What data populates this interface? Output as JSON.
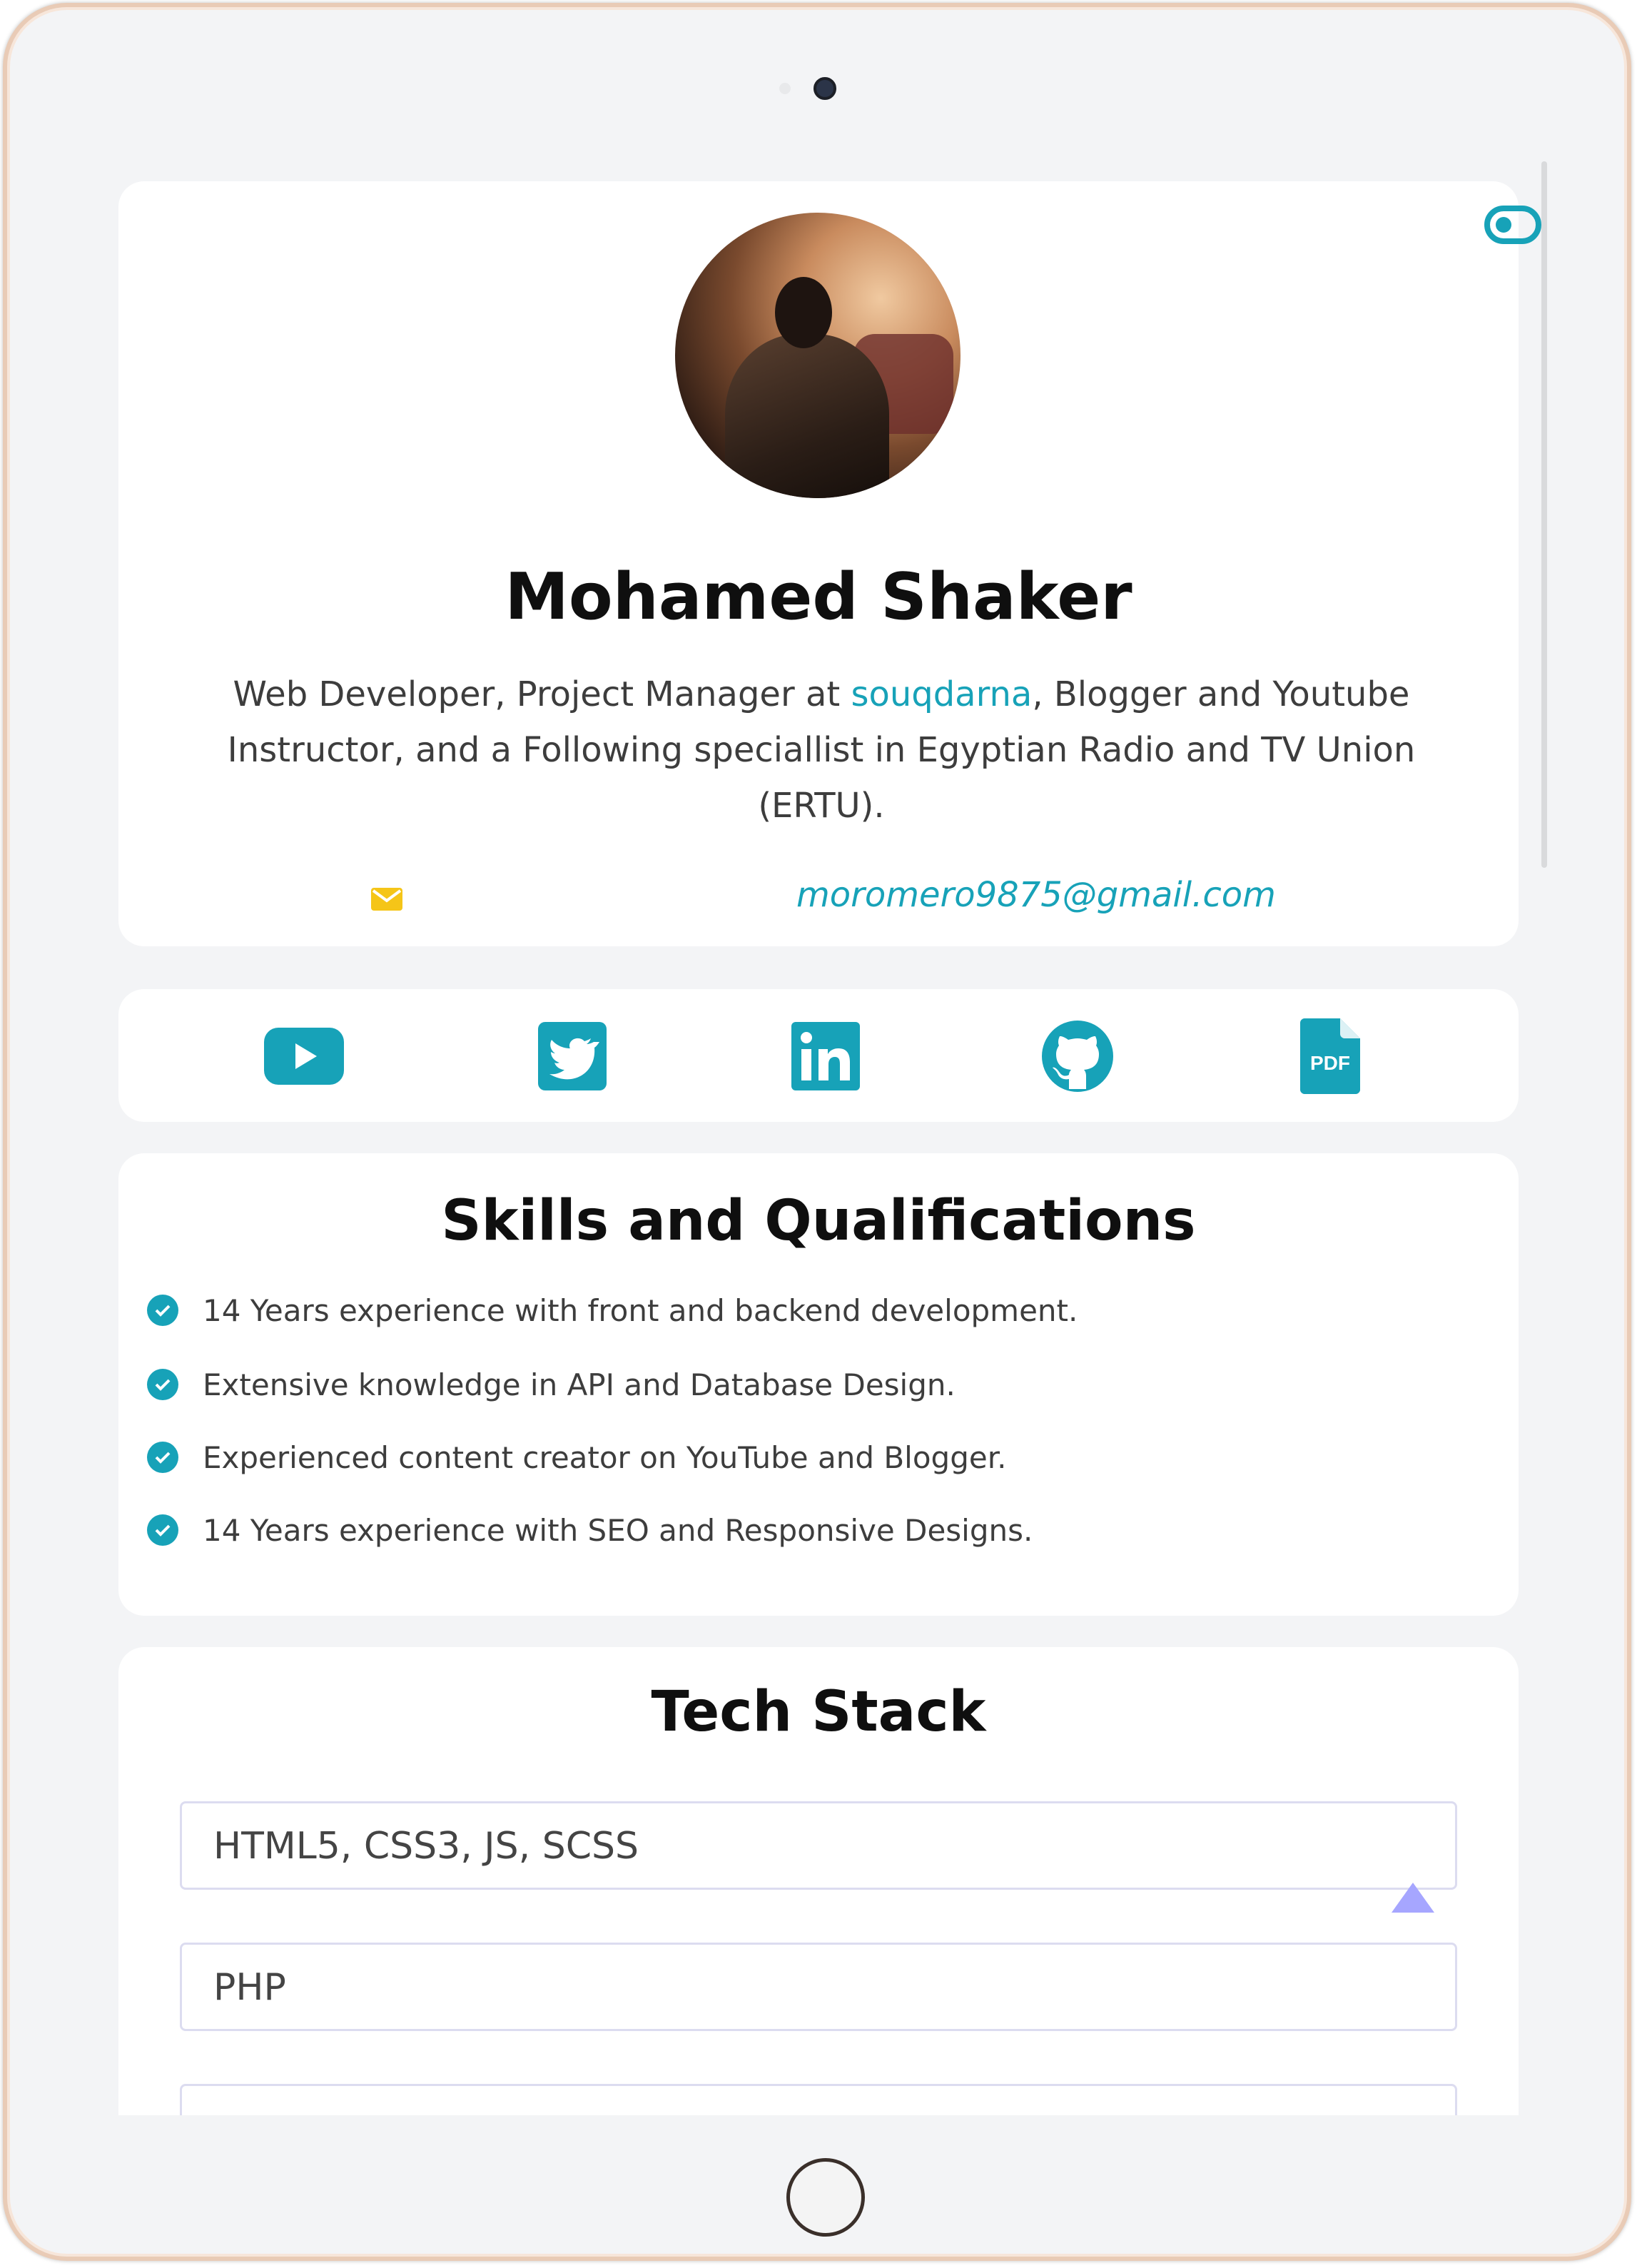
{
  "profile": {
    "name": "Mohamed Shaker",
    "bio_part1": "Web Developer, Project Manager at ",
    "bio_link": "souqdarna",
    "bio_part2": ", Blogger and Youtube Instructor, and a Following speciallist in Egyptian Radio and TV Union (ERTU).",
    "email": "moromero9875@gmail.com"
  },
  "social": [
    {
      "icon": "youtube-icon"
    },
    {
      "icon": "twitter-icon"
    },
    {
      "icon": "linkedin-icon"
    },
    {
      "icon": "github-icon"
    },
    {
      "icon": "pdf-icon",
      "label": "PDF"
    }
  ],
  "skills": {
    "title": "Skills and Qualifications",
    "items": [
      "14 Years experience with front and backend development.",
      "Extensive knowledge in API and Database Design.",
      "Experienced content creator on YouTube and Blogger.",
      "14 Years experience with SEO and Responsive Designs."
    ]
  },
  "tech_stack": {
    "title": "Tech Stack",
    "items": [
      "HTML5, CSS3, JS, SCSS",
      "PHP",
      ""
    ]
  },
  "colors": {
    "accent": "#17a2b8",
    "mail_icon": "#f5c518",
    "scroll_top": "#a6a6ff",
    "device_frame": "#e9cbb6"
  }
}
